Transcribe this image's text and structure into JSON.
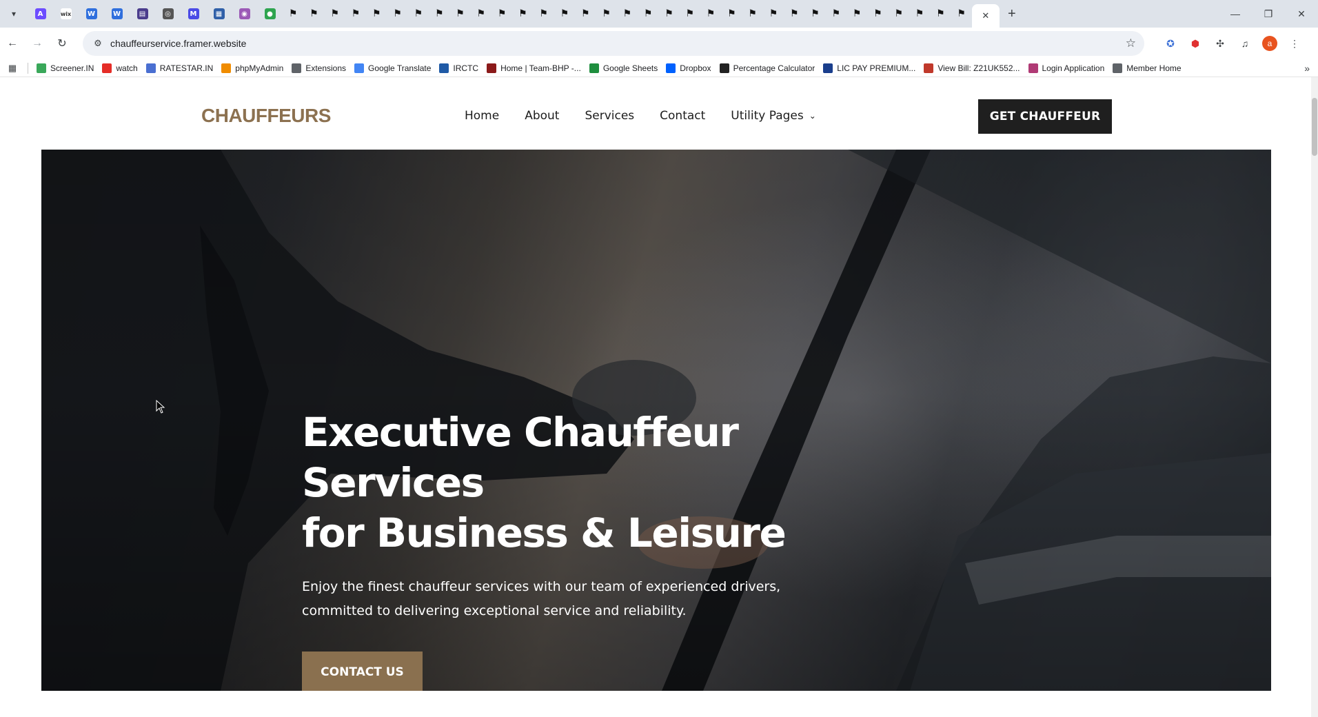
{
  "browser": {
    "pinned_tabs": [
      {
        "icon": "app-icon",
        "color": "#6c4cff",
        "glyph": "A"
      },
      {
        "icon": "wix-icon",
        "color": "#ffffff",
        "glyph": "wix"
      },
      {
        "icon": "doc-icon",
        "color": "#2f6fdd",
        "glyph": "W"
      },
      {
        "icon": "doc-icon",
        "color": "#2f6fdd",
        "glyph": "W"
      },
      {
        "icon": "app-icon",
        "color": "#4a3c8c",
        "glyph": "▤"
      },
      {
        "icon": "app-icon",
        "color": "#555555",
        "glyph": "◎"
      },
      {
        "icon": "app-icon",
        "color": "#4a4ae6",
        "glyph": "M"
      },
      {
        "icon": "app-icon",
        "color": "#2f5fa8",
        "glyph": "▦"
      },
      {
        "icon": "app-icon",
        "color": "#9b59b6",
        "glyph": "◉"
      },
      {
        "icon": "app-icon",
        "color": "#2ea44f",
        "glyph": "●"
      }
    ],
    "framer_tab_count": 33,
    "url": "chauffeurservice.framer.website",
    "bookmarks": [
      {
        "label": "Screener.IN",
        "icon": "chart-icon",
        "color": "#3aa85a"
      },
      {
        "label": "watch",
        "icon": "youtube-icon",
        "color": "#e52d27"
      },
      {
        "label": "RATESTAR.IN",
        "icon": "star-icon",
        "color": "#4a6fd1"
      },
      {
        "label": "phpMyAdmin",
        "icon": "phpmyadmin-icon",
        "color": "#f08c00"
      },
      {
        "label": "Extensions",
        "icon": "puzzle-icon",
        "color": "#5f6368"
      },
      {
        "label": "Google Translate",
        "icon": "translate-icon",
        "color": "#4285f4"
      },
      {
        "label": "IRCTC",
        "icon": "irctc-icon",
        "color": "#1f5aa6"
      },
      {
        "label": "Home | Team-BHP -...",
        "icon": "teambhp-icon",
        "color": "#8b1a1a"
      },
      {
        "label": "Google Sheets",
        "icon": "sheets-icon",
        "color": "#1e8e3e"
      },
      {
        "label": "Dropbox",
        "icon": "dropbox-icon",
        "color": "#0061fe"
      },
      {
        "label": "Percentage Calculator",
        "icon": "calculator-icon",
        "color": "#222222"
      },
      {
        "label": "LIC PAY PREMIUM...",
        "icon": "lic-icon",
        "color": "#1a3e8c"
      },
      {
        "label": "View Bill: Z21UK552...",
        "icon": "bill-icon",
        "color": "#c0392b"
      },
      {
        "label": "Login Application",
        "icon": "login-icon",
        "color": "#b03a75"
      },
      {
        "label": "Member Home",
        "icon": "globe-icon",
        "color": "#5f6368"
      }
    ]
  },
  "site": {
    "logo": "CHAUFFEURS",
    "nav": [
      "Home",
      "About",
      "Services",
      "Contact",
      "Utility Pages"
    ],
    "cta": "GET CHAUFFEUR",
    "hero": {
      "title_line1": "Executive Chauffeur Services",
      "title_line2": "for Business & Leisure",
      "subtitle": "Enjoy the finest chauffeur services with our team of experienced drivers, committed to delivering exceptional service and reliability.",
      "button": "CONTACT US"
    },
    "colors": {
      "brand": "#8c7150",
      "button_dark": "#1f1f1f",
      "button_gold": "#8a704f"
    }
  }
}
